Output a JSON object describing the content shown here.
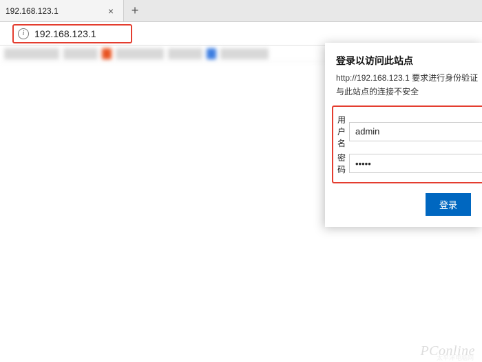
{
  "tab": {
    "title": "192.168.123.1"
  },
  "address": {
    "url": "192.168.123.1"
  },
  "auth": {
    "title": "登录以访问此站点",
    "subtext": "http://192.168.123.1 要求进行身份验证",
    "warning": "与此站点的连接不安全",
    "username_label": "用户名",
    "username_value": "admin",
    "password_label": "密码",
    "password_value": "•••••",
    "login_label": "登录"
  },
  "watermark": {
    "main": "PConline",
    "sub": "太平洋电脑网"
  }
}
